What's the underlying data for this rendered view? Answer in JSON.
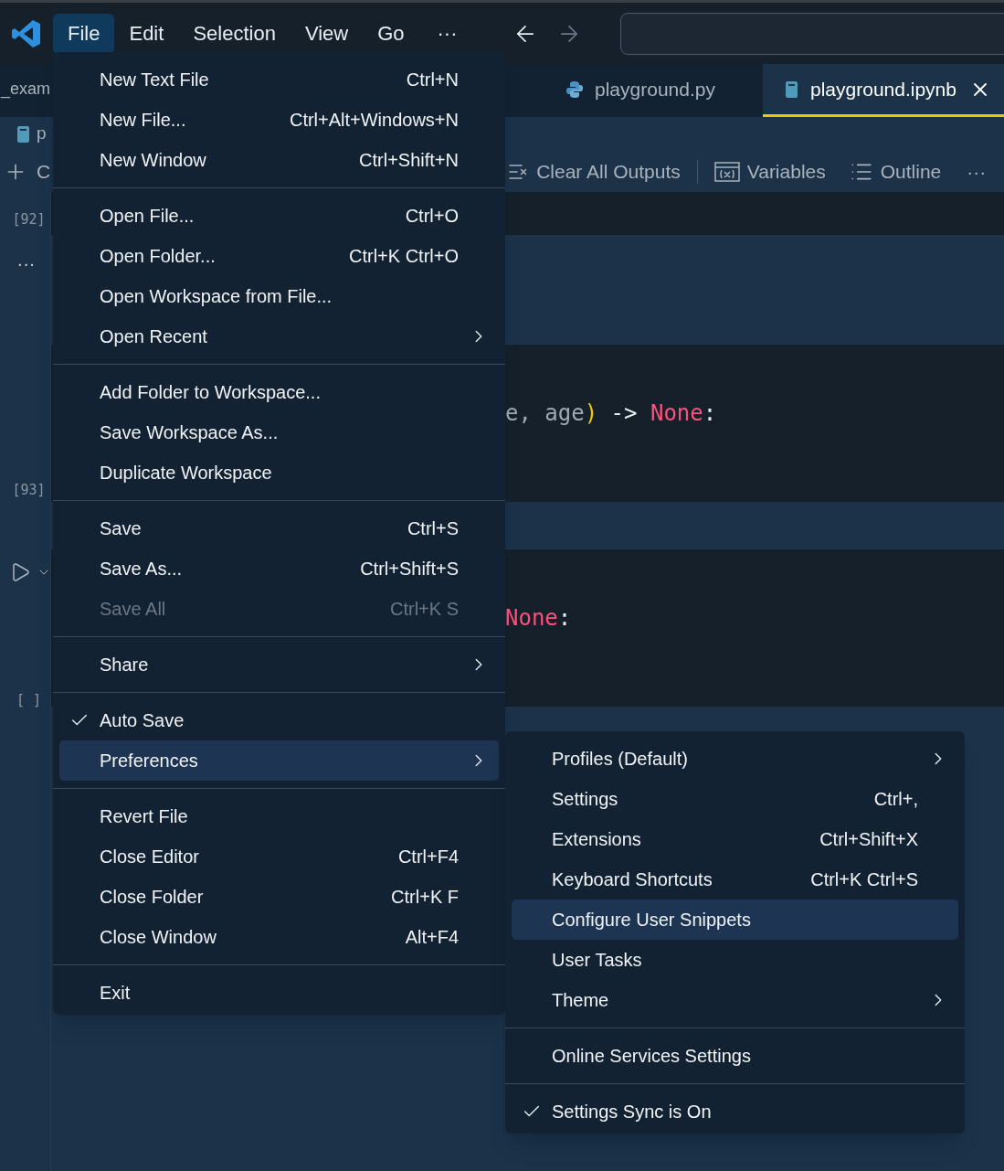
{
  "menubar": {
    "items": [
      {
        "label": "File",
        "selected": true
      },
      {
        "label": "Edit",
        "selected": false
      },
      {
        "label": "Selection",
        "selected": false
      },
      {
        "label": "View",
        "selected": false
      },
      {
        "label": "Go",
        "selected": false
      }
    ],
    "more": "···"
  },
  "tabs": [
    {
      "label": "_exam",
      "selected": false,
      "kind": "plain"
    },
    {
      "label": "playground.py",
      "selected": false,
      "kind": "python"
    },
    {
      "label": "playground.ipynb",
      "selected": true,
      "kind": "notebook"
    }
  ],
  "breadcrumb": "p",
  "toolbar": {
    "add_label": "C",
    "items": [
      {
        "label": "Clear All Outputs",
        "kind": "clear"
      },
      {
        "label": "Variables",
        "kind": "variables"
      },
      {
        "label": "Outline",
        "kind": "outline"
      }
    ],
    "more": "···"
  },
  "gutter": [
    {
      "kind": "count",
      "text": "[92]"
    },
    {
      "kind": "dots",
      "text": "···"
    },
    {
      "kind": "count",
      "text": "[93]"
    },
    {
      "kind": "run"
    },
    {
      "kind": "count",
      "text": "[ ]"
    }
  ],
  "code_lines": [
    [
      {
        "text": "e, age",
        "kind": "variable"
      },
      {
        "text": ")",
        "kind": "bracket"
      },
      {
        "text": " -> ",
        "kind": "operator"
      },
      {
        "text": "None",
        "kind": "keyword"
      },
      {
        "text": ":",
        "kind": "punctuation"
      }
    ],
    [
      {
        "text": "None",
        "kind": "keyword"
      },
      {
        "text": ":",
        "kind": "punctuation"
      }
    ]
  ],
  "file_menu": [
    [
      {
        "label": "New Text File",
        "shortcut": "Ctrl+N",
        "submenu": false,
        "disabled": false,
        "checked": false,
        "selected": false
      },
      {
        "label": "New File...",
        "shortcut": "Ctrl+Alt+Windows+N",
        "submenu": false,
        "disabled": false,
        "checked": false,
        "selected": false
      },
      {
        "label": "New Window",
        "shortcut": "Ctrl+Shift+N",
        "submenu": false,
        "disabled": false,
        "checked": false,
        "selected": false
      }
    ],
    [
      {
        "label": "Open File...",
        "shortcut": "Ctrl+O",
        "submenu": false,
        "disabled": false,
        "checked": false,
        "selected": false
      },
      {
        "label": "Open Folder...",
        "shortcut": "Ctrl+K Ctrl+O",
        "submenu": false,
        "disabled": false,
        "checked": false,
        "selected": false
      },
      {
        "label": "Open Workspace from File...",
        "submenu": false,
        "disabled": false,
        "checked": false,
        "selected": false
      },
      {
        "label": "Open Recent",
        "submenu": true,
        "disabled": false,
        "checked": false,
        "selected": false
      }
    ],
    [
      {
        "label": "Add Folder to Workspace...",
        "submenu": false,
        "disabled": false,
        "checked": false,
        "selected": false
      },
      {
        "label": "Save Workspace As...",
        "submenu": false,
        "disabled": false,
        "checked": false,
        "selected": false
      },
      {
        "label": "Duplicate Workspace",
        "submenu": false,
        "disabled": false,
        "checked": false,
        "selected": false
      }
    ],
    [
      {
        "label": "Save",
        "shortcut": "Ctrl+S",
        "submenu": false,
        "disabled": false,
        "checked": false,
        "selected": false
      },
      {
        "label": "Save As...",
        "shortcut": "Ctrl+Shift+S",
        "submenu": false,
        "disabled": false,
        "checked": false,
        "selected": false
      },
      {
        "label": "Save All",
        "shortcut": "Ctrl+K S",
        "submenu": false,
        "disabled": true,
        "checked": false,
        "selected": false
      }
    ],
    [
      {
        "label": "Share",
        "submenu": true,
        "disabled": false,
        "checked": false,
        "selected": false
      }
    ],
    [
      {
        "label": "Auto Save",
        "submenu": false,
        "disabled": false,
        "checked": true,
        "selected": false
      },
      {
        "label": "Preferences",
        "submenu": true,
        "disabled": false,
        "checked": false,
        "selected": true
      }
    ],
    [
      {
        "label": "Revert File",
        "submenu": false,
        "disabled": false,
        "checked": false,
        "selected": false
      },
      {
        "label": "Close Editor",
        "shortcut": "Ctrl+F4",
        "submenu": false,
        "disabled": false,
        "checked": false,
        "selected": false
      },
      {
        "label": "Close Folder",
        "shortcut": "Ctrl+K F",
        "submenu": false,
        "disabled": false,
        "checked": false,
        "selected": false
      },
      {
        "label": "Close Window",
        "shortcut": "Alt+F4",
        "submenu": false,
        "disabled": false,
        "checked": false,
        "selected": false
      }
    ],
    [
      {
        "label": "Exit",
        "submenu": false,
        "disabled": false,
        "checked": false,
        "selected": false
      }
    ]
  ],
  "preferences_menu": [
    [
      {
        "label": "Profiles (Default)",
        "submenu": true,
        "disabled": false,
        "checked": false,
        "selected": false
      },
      {
        "label": "Settings",
        "shortcut": "Ctrl+,",
        "submenu": false,
        "disabled": false,
        "checked": false,
        "selected": false
      },
      {
        "label": "Extensions",
        "shortcut": "Ctrl+Shift+X",
        "submenu": false,
        "disabled": false,
        "checked": false,
        "selected": false
      },
      {
        "label": "Keyboard Shortcuts",
        "shortcut": "Ctrl+K Ctrl+S",
        "submenu": false,
        "disabled": false,
        "checked": false,
        "selected": false
      },
      {
        "label": "Configure User Snippets",
        "submenu": false,
        "disabled": false,
        "checked": false,
        "selected": true
      },
      {
        "label": "User Tasks",
        "submenu": false,
        "disabled": false,
        "checked": false,
        "selected": false
      },
      {
        "label": "Theme",
        "submenu": true,
        "disabled": false,
        "checked": false,
        "selected": false
      }
    ],
    [
      {
        "label": "Online Services Settings",
        "submenu": false,
        "disabled": false,
        "checked": false,
        "selected": false
      }
    ],
    [
      {
        "label": "Settings Sync is On",
        "submenu": false,
        "disabled": false,
        "checked": true,
        "selected": false
      }
    ]
  ]
}
